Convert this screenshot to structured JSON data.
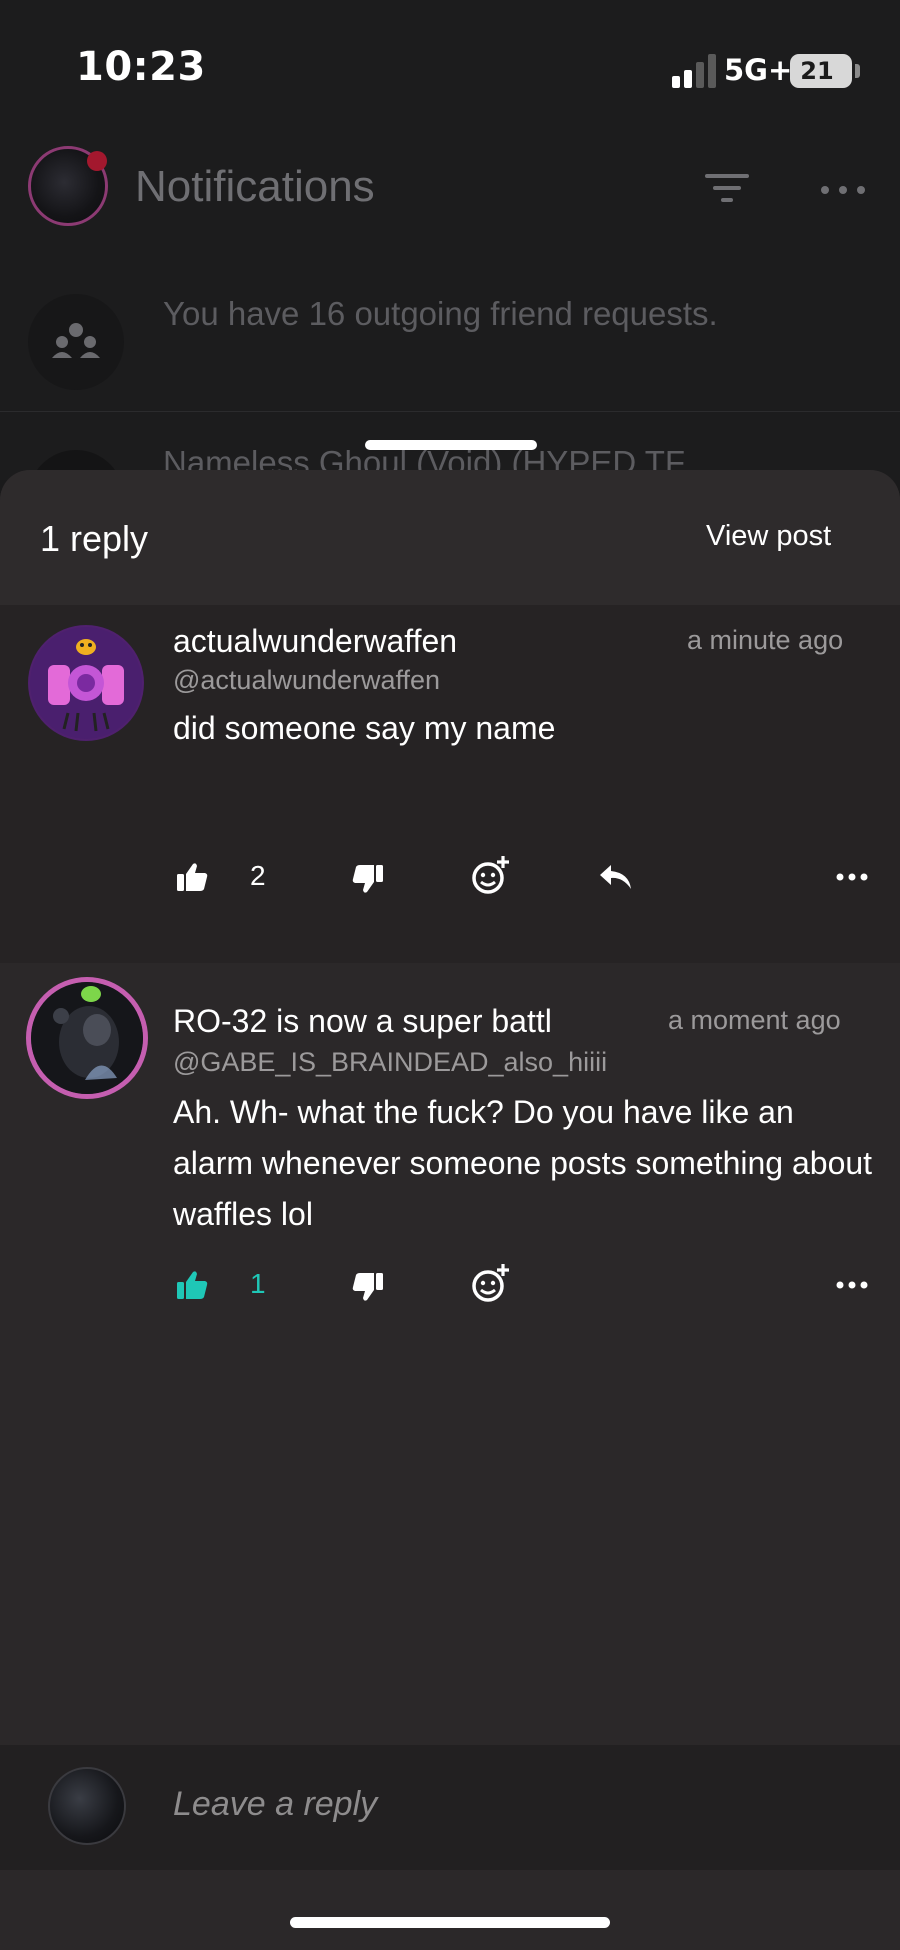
{
  "status_bar": {
    "time": "10:23",
    "network": "5G+",
    "battery": "21"
  },
  "background": {
    "title": "Notifications",
    "outgoing_text": "You have 16 outgoing friend requests.",
    "peek_text": "Nameless Ghoul (Void) (HYPED TF"
  },
  "sheet": {
    "title": "1 reply",
    "view_post": "View post"
  },
  "comments": [
    {
      "username": "actualwunderwaffen",
      "handle": "@actualwunderwaffen",
      "timestamp": "a minute ago",
      "text": "did someone say my name",
      "likes": "2",
      "liked": false
    },
    {
      "username": "RO-32 is now a super battl",
      "handle": "@GABE_IS_BRAINDEAD_also_hiiii",
      "timestamp": "a moment ago",
      "text": "Ah. Wh- what the fuck? Do you have like an alarm whenever someone posts something about waffles lol",
      "likes": "1",
      "liked": true
    }
  ],
  "reply_bar": {
    "placeholder": "Leave a reply"
  },
  "colors": {
    "accent": "#1fc7b6",
    "sheet_bg": "#2b2829",
    "text_muted": "#9c9a9b"
  },
  "icons": [
    "filter-icon",
    "more-icon",
    "group-icon",
    "thumbs-up-icon",
    "thumbs-down-icon",
    "add-reaction-icon",
    "reply-icon"
  ]
}
